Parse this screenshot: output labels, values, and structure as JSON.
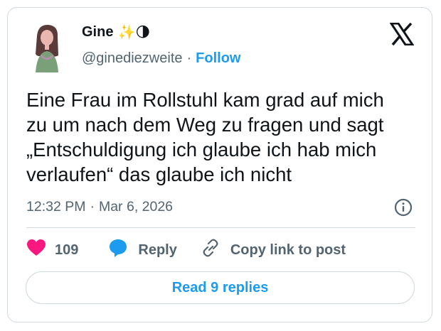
{
  "author": {
    "name": "Gine",
    "name_emojis": "✨🌗",
    "handle": "@ginediezweite",
    "separator": "·",
    "follow_label": "Follow"
  },
  "tweet": {
    "text": "Eine Frau im Rollstuhl kam grad auf mich\nzu um nach dem Weg zu fragen und sagt\n„Entschuldigung ich glaube ich hab mich\nverlaufen“ das glaube ich nicht",
    "time": "12:32 PM",
    "separator": "·",
    "date": "Mar 6, 2026"
  },
  "actions": {
    "like_count": "109",
    "reply_label": "Reply",
    "copy_label": "Copy link to post"
  },
  "read_replies_label": "Read 9 replies",
  "icons": {
    "logo": "x-logo-icon",
    "info": "info-icon",
    "like": "heart-icon",
    "reply": "speech-bubble-icon",
    "copy": "link-icon"
  },
  "colors": {
    "accent": "#1d9bf0",
    "heart": "#f91880",
    "muted": "#536471",
    "text": "#0f1419",
    "border": "#cfd9de"
  }
}
